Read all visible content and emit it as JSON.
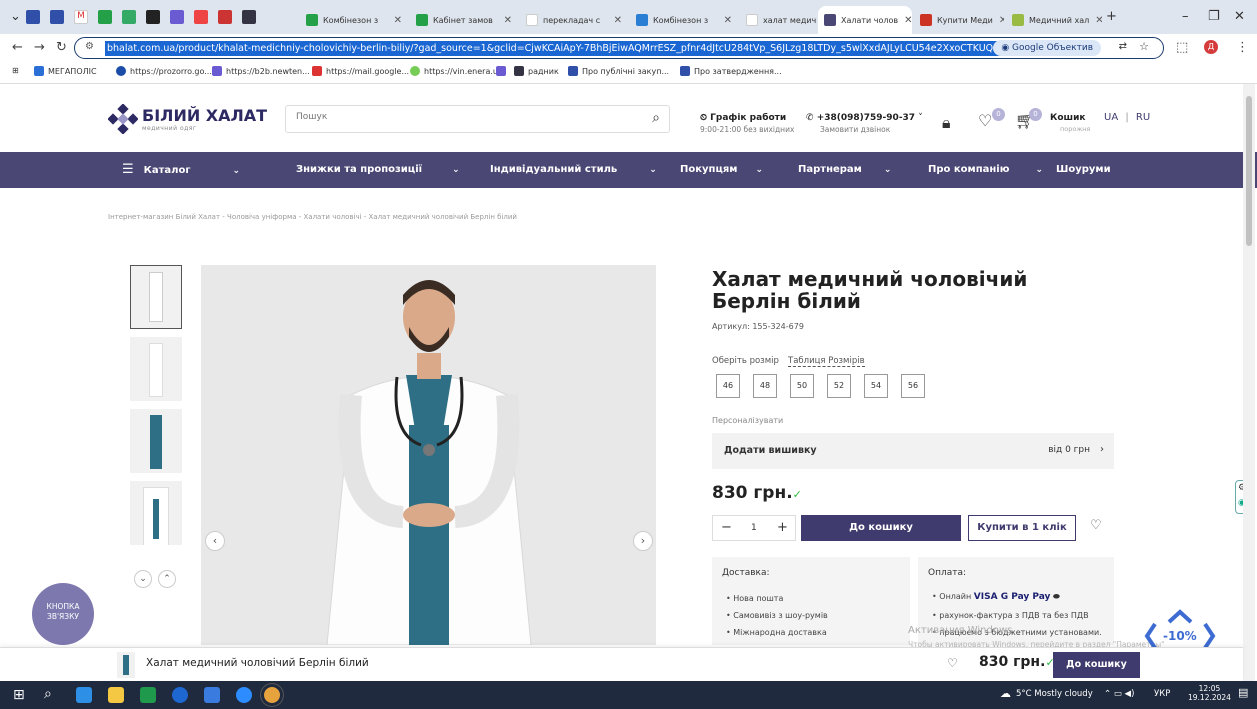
{
  "browser": {
    "tabs": [
      {
        "label": "Комбінезон з",
        "active": false
      },
      {
        "label": "Кабінет замов",
        "active": false
      },
      {
        "label": "перекладач с",
        "active": false
      },
      {
        "label": "Комбінезон з",
        "active": false
      },
      {
        "label": "халат медичн",
        "active": false
      },
      {
        "label": "Халати чолов",
        "active": true
      },
      {
        "label": "Купити Меди",
        "active": false
      },
      {
        "label": "Медичний хал",
        "active": false
      }
    ],
    "new_tab": "+",
    "url": "bhalat.com.ua/product/khalat-medichniy-cholovichiy-berlin-biliy/?gad_source=1&gclid=CjwKCAiApY-7BhBjEiwAQMrrESZ_pfnr4dJtcU284tVp_S6JLzg18LTDy_s5wlXxdAJLyLCU54e2XxoCTKUQAvD_BwE",
    "lens_label": "Google Объектив",
    "bookmarks": [
      "МЕГАПОЛІС",
      "https://prozorro.go...",
      "https://b2b.newten...",
      "https://mail.google...",
      "https://vin.enera.ua/",
      "радник",
      "Про публічні закуп...",
      "Про затвердження..."
    ]
  },
  "header": {
    "logo_name": "БІЛИЙ ХАЛАТ",
    "logo_tagline": "медичний одяг",
    "search_placeholder": "Пошук",
    "schedule_title": "Графік работи",
    "schedule_hours": "9:00-21:00 без вихідних",
    "phone": "+38(098)759-90-37",
    "callback": "Замовити дзвінок",
    "wishlist_count": "0",
    "cart_count": "0",
    "cart_title": "Кошик",
    "cart_status": "порожня",
    "lang_ua": "UA",
    "lang_sep": "|",
    "lang_ru": "RU"
  },
  "nav": [
    "Каталог",
    "Знижки та пропозиції",
    "Індивідуальний стиль",
    "Покупцям",
    "Партнерам",
    "Про компанію",
    "Шоуруми"
  ],
  "breadcrumb": "Інтернет-магазин Білий Халат - Чоловіча уніформа - Халати чоловічі - Халат медичний чоловічий Берлін білий",
  "product": {
    "title": "Халат медичний чоловічий Берлін білий",
    "sku": "Артикул: 155-324-679",
    "size_label": "Оберіть розмір",
    "size_table": "Таблиця Розмірів",
    "sizes": [
      "46",
      "48",
      "50",
      "52",
      "54",
      "56"
    ],
    "personalize": "Персоналізувати",
    "embroidery": "Додати вишивку",
    "embroidery_price": "від 0 грн",
    "price": "830 грн.",
    "quantity": "1",
    "add_to_cart": "До кошику",
    "buy_one_click": "Купити в 1 клік"
  },
  "delivery": {
    "title": "Доставка:",
    "items": [
      "Нова пошта",
      "Самовивіз з шоу-румів",
      "Міжнародна доставка"
    ]
  },
  "payment": {
    "title": "Оплата:",
    "items": [
      "Онлайн",
      "рахунок-фактура з ПДВ та без ПДВ",
      "працюємо з бюджетними установами."
    ],
    "brands": "VISA G Pay Pay"
  },
  "watermark": {
    "line1": "Активация Windows",
    "line2": "Чтобы активировать Windows, перейдите в раздел \"Параметры\""
  },
  "contact_button": "КНОПКА ЗВ'ЯЗКУ",
  "discount_badge": "-10%",
  "sticky": {
    "title": "Халат медичний чоловічий Берлін білий",
    "price": "830 грн.",
    "button": "До кошику"
  },
  "taskbar": {
    "weather": "5°C  Mostly cloudy",
    "lang": "УКР",
    "time": "12:05",
    "date": "19.12.2024"
  },
  "colors": {
    "brand": "#4a4775",
    "button": "#3f3b6e",
    "stock_tick": "#2dbb3e",
    "discount": "#3c6bd1"
  }
}
